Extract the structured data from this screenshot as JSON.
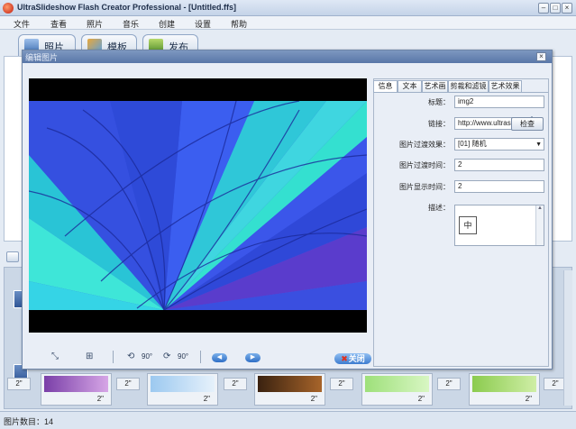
{
  "window": {
    "title": "UltraSlideshow Flash Creator Professional - [Untitled.ffs]",
    "minimize": "–",
    "restore": "□",
    "close": "×"
  },
  "menu": [
    "文件",
    "查看",
    "照片",
    "音乐",
    "创建",
    "设置",
    "帮助"
  ],
  "main_tabs": [
    {
      "label": "照片",
      "icon": "photo-icon"
    },
    {
      "label": "模板",
      "icon": "template-icon"
    },
    {
      "label": "发布",
      "icon": "publish-icon"
    }
  ],
  "filmstrip": {
    "durations": [
      "2\"",
      "2\"",
      "2\"",
      "2\"",
      "2\""
    ],
    "small_durations": [
      "2\"",
      "2\"",
      "2\"",
      "2\"",
      "2\""
    ],
    "side_durations": [
      "2\""
    ]
  },
  "status": {
    "photo_count": "图片数目：14"
  },
  "dialog": {
    "title": "编辑图片",
    "close": "×",
    "tabs": [
      "信息",
      "文本",
      "艺术画",
      "剪裁和滤镜",
      "艺术效果"
    ],
    "fields": {
      "title_label": "标题：",
      "title_value": "img2",
      "link_label": "链接：",
      "link_value": "http://www.ultraslidesho",
      "check_button": "检查",
      "transition_label": "图片过渡效果：",
      "transition_value": "[01] 随机",
      "transition_time_label": "图片过渡时间：",
      "transition_time_value": "2",
      "display_time_label": "图片显示时间：",
      "display_time_value": "2",
      "description_label": "描述：",
      "ime_indicator": "中"
    },
    "toolbar": {
      "rotate_left_text": "90°",
      "rotate_right_text": "90°",
      "close_label": "关闭"
    }
  },
  "colors": {
    "accent": "#3c7ccf",
    "dialog_title": "#5977a8"
  }
}
